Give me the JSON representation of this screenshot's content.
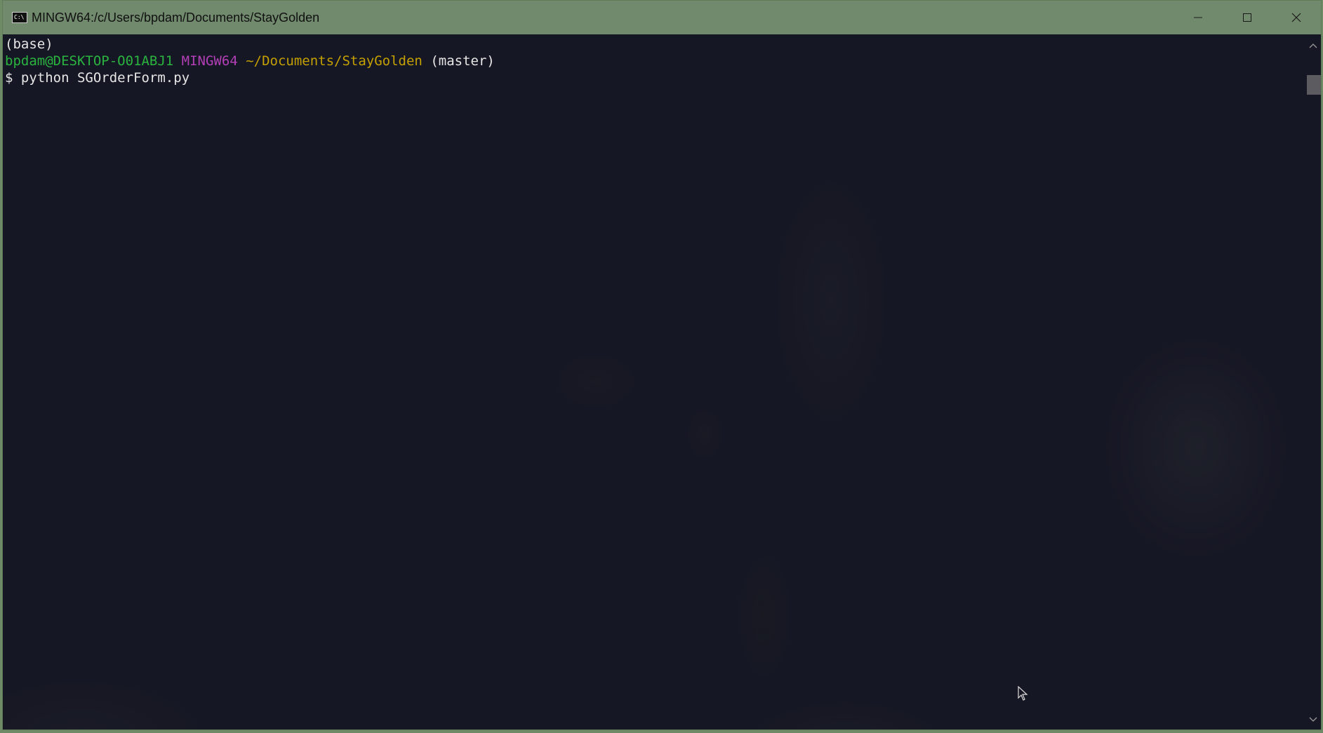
{
  "window": {
    "title": "MINGW64:/c/Users/bpdam/Documents/StayGolden",
    "icon": "terminal-icon",
    "controls": [
      "minimize-icon",
      "maximize-icon",
      "close-icon"
    ]
  },
  "terminal": {
    "line1": "(base)",
    "prompt": {
      "user_host": "bpdam@DESKTOP-O01ABJ1",
      "system": "MINGW64",
      "path": "~/Documents/StayGolden",
      "branch": "(master)"
    },
    "command": "$ python SGOrderForm.py"
  },
  "colors": {
    "user_host": "#2ab43f",
    "system": "#b23fb6",
    "path": "#c4a000",
    "background": "#161724",
    "titlebar": "#71896d"
  }
}
